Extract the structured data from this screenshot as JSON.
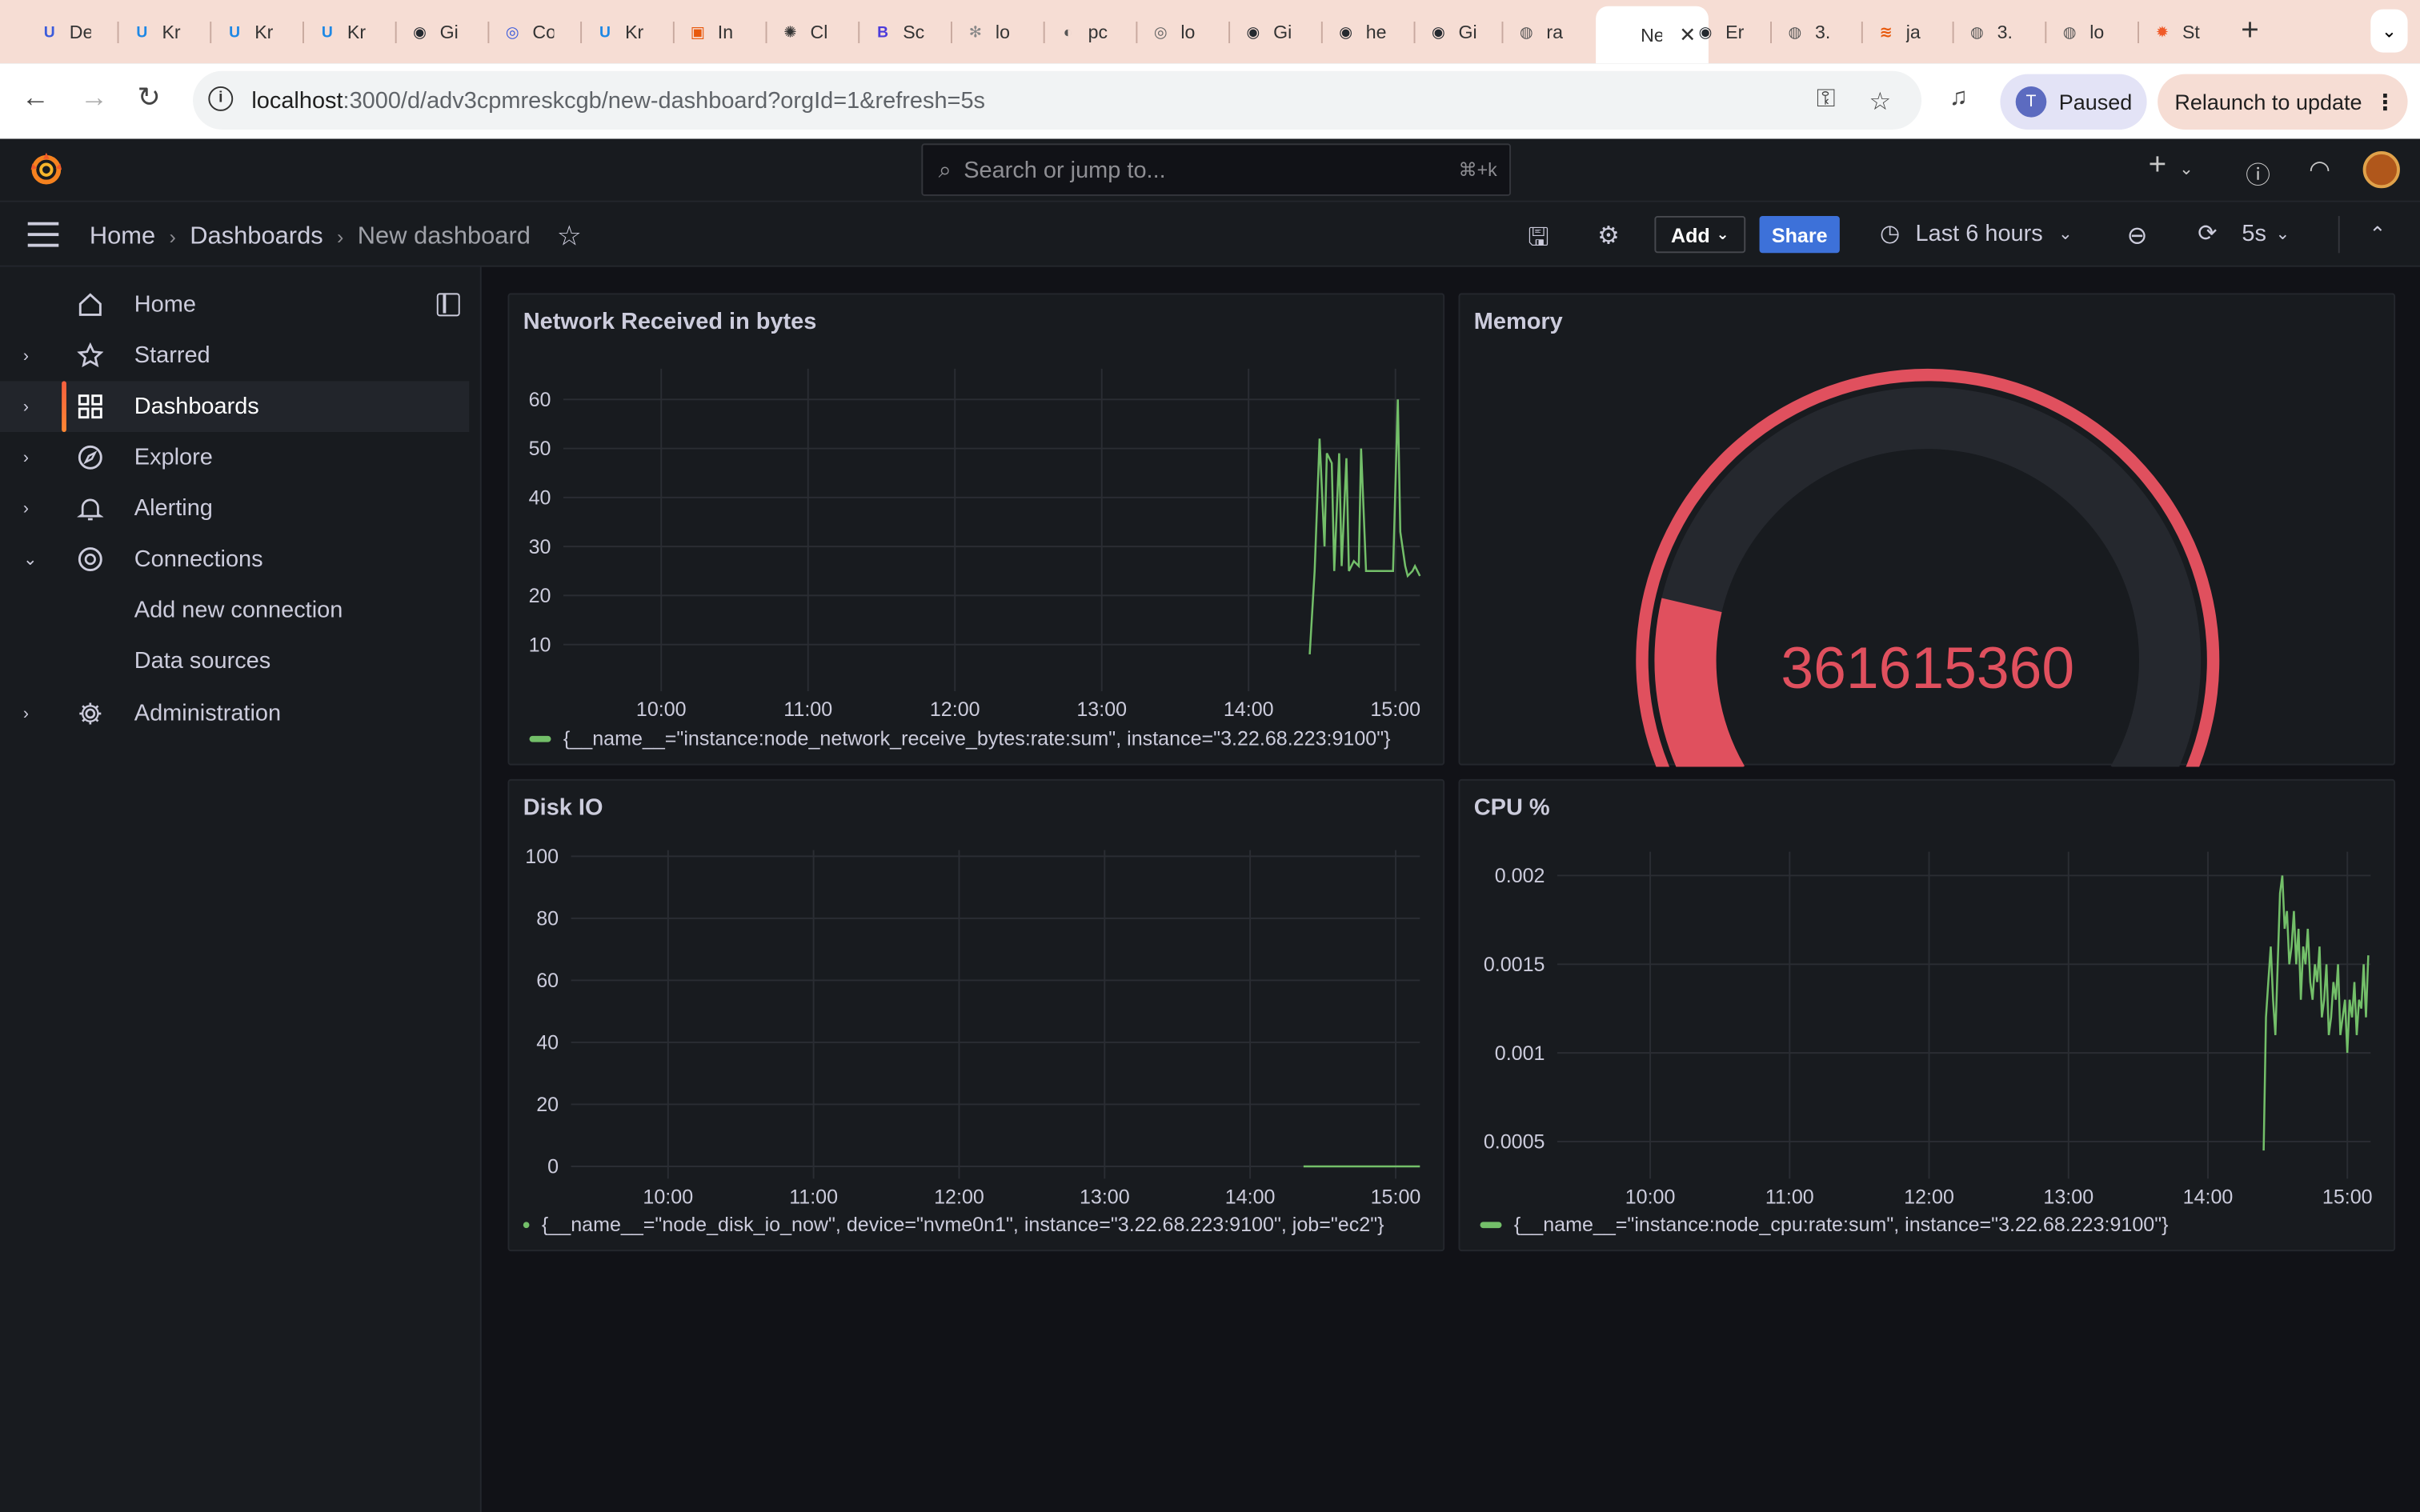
{
  "browser": {
    "tabs": [
      {
        "title": "De",
        "color": "#3b5bdb",
        "glyph": "U"
      },
      {
        "title": "Kr",
        "color": "#1e88e5",
        "glyph": "U"
      },
      {
        "title": "Kr",
        "color": "#1e88e5",
        "glyph": "U"
      },
      {
        "title": "Kr",
        "color": "#1e88e5",
        "glyph": "U"
      },
      {
        "title": "Gi",
        "color": "#24292f",
        "glyph": "◉"
      },
      {
        "title": "Co",
        "color": "#3b5bdb",
        "glyph": "◎"
      },
      {
        "title": "Kr",
        "color": "#1e88e5",
        "glyph": "U"
      },
      {
        "title": "In",
        "color": "#e8590c",
        "glyph": "▣"
      },
      {
        "title": "Cl",
        "color": "#333333",
        "glyph": "✺"
      },
      {
        "title": "Sc",
        "color": "#4c3bdb",
        "glyph": "B"
      },
      {
        "title": "lo",
        "color": "#888888",
        "glyph": "✻"
      },
      {
        "title": "pc",
        "color": "#555555",
        "glyph": "◐"
      },
      {
        "title": "lo",
        "color": "#666666",
        "glyph": "◎"
      },
      {
        "title": "Gi",
        "color": "#24292f",
        "glyph": "◉"
      },
      {
        "title": "he",
        "color": "#24292f",
        "glyph": "◉"
      },
      {
        "title": "Gi",
        "color": "#24292f",
        "glyph": "◉"
      },
      {
        "title": "ra",
        "color": "#555555",
        "glyph": "◍"
      },
      {
        "title": "Ne",
        "color": "#555555",
        "glyph": "",
        "active": true
      },
      {
        "title": "Er",
        "color": "#24292f",
        "glyph": "◉"
      },
      {
        "title": "3.",
        "color": "#555555",
        "glyph": "◍"
      },
      {
        "title": "ja",
        "color": "#e8590c",
        "glyph": "≋"
      },
      {
        "title": "3.",
        "color": "#555555",
        "glyph": "◍"
      },
      {
        "title": "lo",
        "color": "#555555",
        "glyph": "◍"
      },
      {
        "title": "St",
        "color": "#f05a28",
        "glyph": "✹"
      }
    ],
    "new_tab_label": "+",
    "tab_menu_label": "⌄",
    "url_host": "localhost",
    "url_path": ":3000/d/adv3cpmreskcgb/new-dashboard?orgId=1&refresh=5s",
    "profile_initial": "T",
    "profile_label": "Paused",
    "relaunch_label": "Relaunch to update"
  },
  "grafana": {
    "search_placeholder": "Search or jump to...",
    "search_shortcut": "⌘+k",
    "breadcrumb": [
      "Home",
      "Dashboards",
      "New dashboard"
    ],
    "add_label": "Add",
    "share_label": "Share",
    "time_range": "Last 6 hours",
    "refresh_interval": "5s",
    "accent": "#f55f3e"
  },
  "sidebar": {
    "items": [
      {
        "label": "Home",
        "icon": "home-icon",
        "chevron": "",
        "active": false,
        "sub": false
      },
      {
        "label": "Starred",
        "icon": "star-icon",
        "chevron": "›",
        "active": false,
        "sub": false
      },
      {
        "label": "Dashboards",
        "icon": "apps-icon",
        "chevron": "›",
        "active": true,
        "sub": false
      },
      {
        "label": "Explore",
        "icon": "compass-icon",
        "chevron": "›",
        "active": false,
        "sub": false
      },
      {
        "label": "Alerting",
        "icon": "bell-icon",
        "chevron": "›",
        "active": false,
        "sub": false
      },
      {
        "label": "Connections",
        "icon": "connections-icon",
        "chevron": "⌄",
        "active": false,
        "sub": false
      },
      {
        "label": "Add new connection",
        "icon": "",
        "chevron": "",
        "active": false,
        "sub": true
      },
      {
        "label": "Data sources",
        "icon": "",
        "chevron": "",
        "active": false,
        "sub": true
      },
      {
        "label": "Administration",
        "icon": "gear-icon",
        "chevron": "›",
        "active": false,
        "sub": false
      }
    ]
  },
  "panels": {
    "network": {
      "title": "Network Received in bytes",
      "legend": "{__name__=\"instance:node_network_receive_bytes:rate:sum\", instance=\"3.22.68.223:9100\"}"
    },
    "memory": {
      "title": "Memory",
      "value": "361615360",
      "fraction": 0.18,
      "color": "#e0505e"
    },
    "disk": {
      "title": "Disk IO",
      "legend": "{__name__=\"node_disk_io_now\", device=\"nvme0n1\", instance=\"3.22.68.223:9100\", job=\"ec2\"}"
    },
    "cpu": {
      "title": "CPU %",
      "legend": "{__name__=\"instance:node_cpu:rate:sum\", instance=\"3.22.68.223:9100\"}"
    }
  },
  "chart_data": [
    {
      "type": "line",
      "title": "Network Received in bytes",
      "x_ticks": [
        "10:00",
        "11:00",
        "12:00",
        "13:00",
        "14:00",
        "15:00"
      ],
      "y_ticks": [
        10,
        20,
        30,
        40,
        50,
        60
      ],
      "xlim": [
        "09:20",
        "15:10"
      ],
      "ylim": [
        3,
        65
      ],
      "series": [
        {
          "name": "{__name__=\"instance:node_network_receive_bytes:rate:sum\", instance=\"3.22.68.223:9100\"}",
          "color": "#73bf69",
          "x": [
            "14:25",
            "14:27",
            "14:29",
            "14:31",
            "14:32",
            "14:34",
            "14:35",
            "14:37",
            "14:38",
            "14:40",
            "14:41",
            "14:43",
            "14:45",
            "14:46",
            "14:48",
            "14:50",
            "14:51",
            "14:53",
            "14:55",
            "14:57",
            "14:59",
            "15:01",
            "15:02",
            "15:04",
            "15:05",
            "15:07",
            "15:08",
            "15:10"
          ],
          "values": [
            8,
            25,
            52,
            30,
            49,
            47,
            25,
            49,
            26,
            48,
            25,
            27,
            26,
            50,
            25,
            25,
            25,
            25,
            25,
            25,
            25,
            60,
            33,
            26,
            24,
            25,
            26,
            24
          ]
        }
      ]
    },
    {
      "type": "line",
      "title": "Disk IO",
      "x_ticks": [
        "10:00",
        "11:00",
        "12:00",
        "13:00",
        "14:00",
        "15:00"
      ],
      "y_ticks": [
        0,
        20,
        40,
        60,
        80,
        100
      ],
      "xlim": [
        "09:20",
        "15:10"
      ],
      "ylim": [
        0,
        100
      ],
      "series": [
        {
          "name": "{__name__=\"node_disk_io_now\", device=\"nvme0n1\", instance=\"3.22.68.223:9100\", job=\"ec2\"}",
          "color": "#73bf69",
          "x": [
            "14:22",
            "15:10"
          ],
          "values": [
            0,
            0
          ]
        }
      ]
    },
    {
      "type": "line",
      "title": "CPU %",
      "x_ticks": [
        "10:00",
        "11:00",
        "12:00",
        "13:00",
        "14:00",
        "15:00"
      ],
      "y_ticks": [
        0.0005,
        0.001,
        0.0015,
        0.002
      ],
      "y_tick_labels": [
        "0.0005",
        "0.001",
        "0.0015",
        "0.002"
      ],
      "xlim": [
        "09:20",
        "15:10"
      ],
      "ylim": [
        0.00036,
        0.0021
      ],
      "series": [
        {
          "name": "{__name__=\"instance:node_cpu:rate:sum\", instance=\"3.22.68.223:9100\"}",
          "color": "#73bf69",
          "x": [
            "14:24",
            "14:25",
            "14:26",
            "14:27",
            "14:28",
            "14:29",
            "14:30",
            "14:31",
            "14:32",
            "14:33",
            "14:34",
            "14:35",
            "14:36",
            "14:37",
            "14:38",
            "14:39",
            "14:40",
            "14:41",
            "14:42",
            "14:43",
            "14:44",
            "14:45",
            "14:46",
            "14:47",
            "14:48",
            "14:49",
            "14:50",
            "14:51",
            "14:52",
            "14:53",
            "14:54",
            "14:55",
            "14:56",
            "14:57",
            "14:58",
            "14:59",
            "15:00",
            "15:01",
            "15:02",
            "15:03",
            "15:04",
            "15:05",
            "15:06",
            "15:07",
            "15:08",
            "15:09"
          ],
          "values": [
            0.00045,
            0.0012,
            0.0014,
            0.0016,
            0.0013,
            0.0011,
            0.0015,
            0.0019,
            0.002,
            0.0017,
            0.0018,
            0.0015,
            0.0016,
            0.0018,
            0.0015,
            0.0017,
            0.0013,
            0.0016,
            0.0015,
            0.0017,
            0.0014,
            0.0013,
            0.0015,
            0.0014,
            0.0016,
            0.0012,
            0.0013,
            0.0015,
            0.0011,
            0.0012,
            0.0014,
            0.0013,
            0.0015,
            0.0011,
            0.0012,
            0.0013,
            0.001,
            0.0013,
            0.0012,
            0.0014,
            0.0011,
            0.0013,
            0.00125,
            0.0015,
            0.0012,
            0.00155
          ]
        }
      ]
    },
    {
      "type": "gauge",
      "title": "Memory",
      "value": 361615360,
      "fraction": 0.18,
      "color": "#e0505e"
    }
  ]
}
